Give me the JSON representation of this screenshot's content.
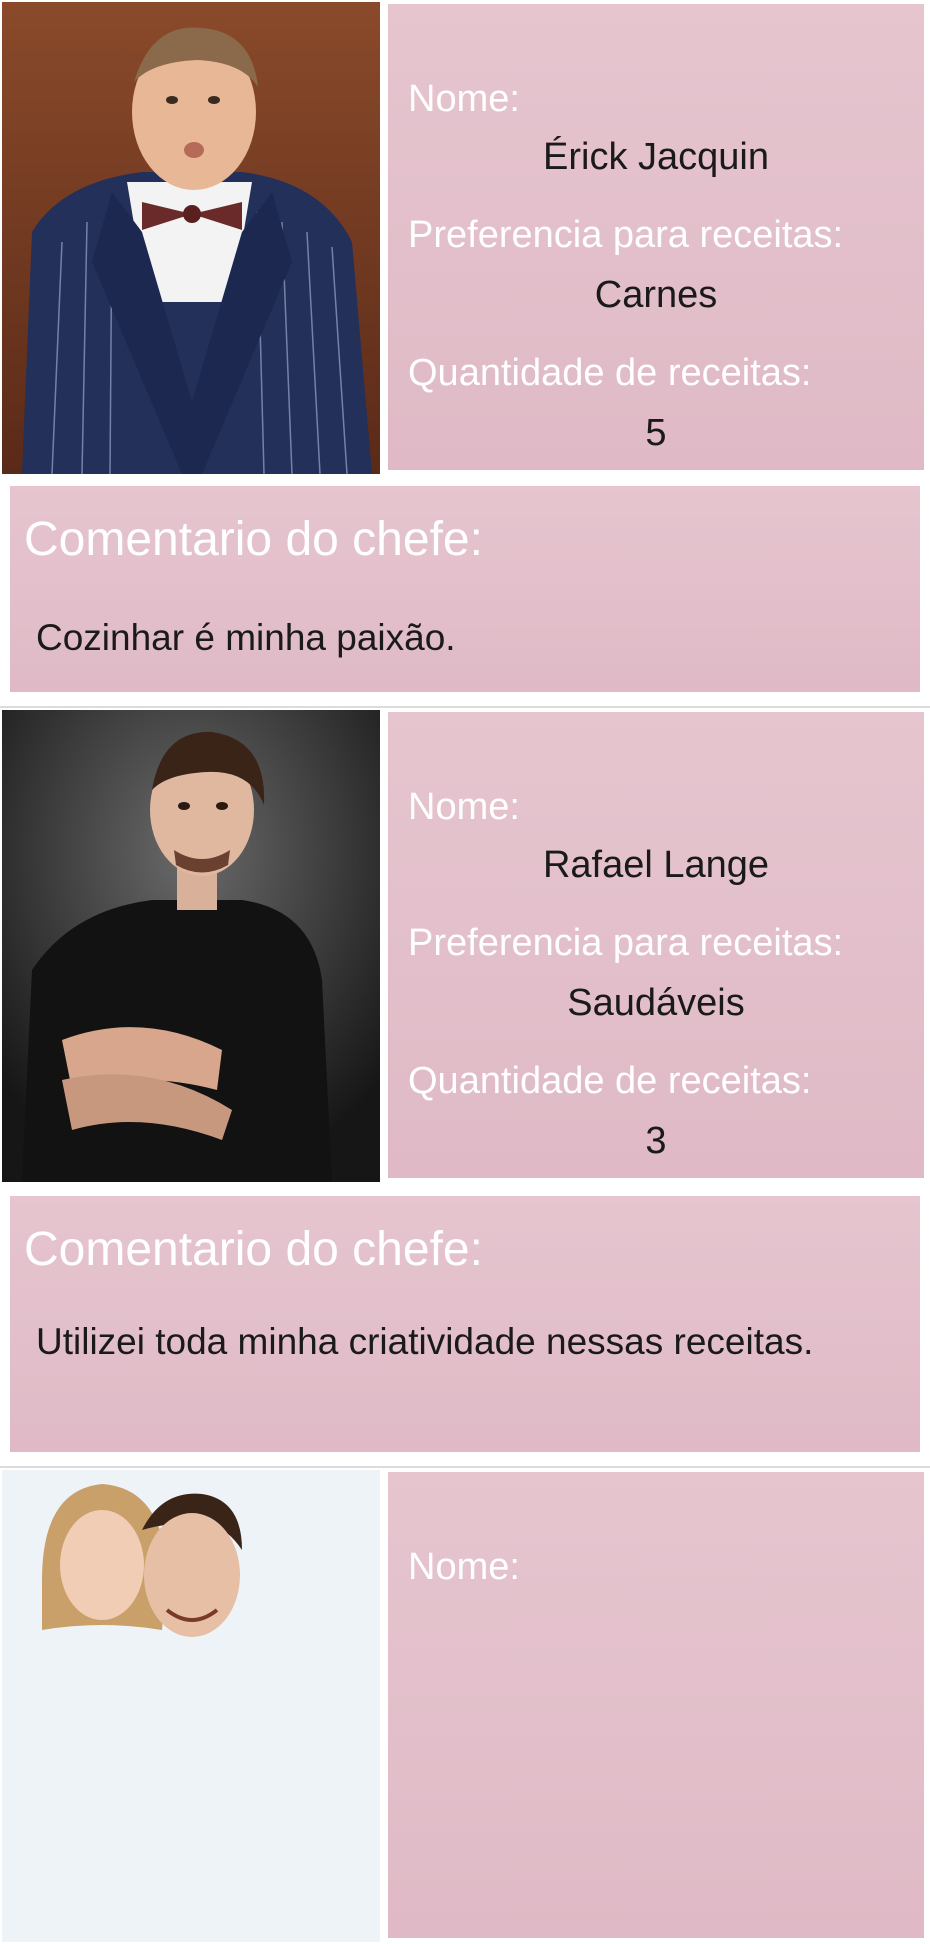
{
  "labels": {
    "name": "Nome:",
    "preference": "Preferencia para receitas:",
    "quantity": "Quantidade de receitas:",
    "comment_title": "Comentario do chefe:"
  },
  "chefs": [
    {
      "name": "Érick Jacquin",
      "preference": "Carnes",
      "quantity": "5",
      "comment": "Cozinhar é minha paixão."
    },
    {
      "name": "Rafael Lange",
      "preference": "Saudáveis",
      "quantity": "3",
      "comment": " Utilizei toda minha criatividade nessas receitas."
    },
    {
      "name": "",
      "preference": "",
      "quantity": "",
      "comment": ""
    }
  ],
  "colors": {
    "card_background": "#e2bfca",
    "label_text": "#ffffff",
    "value_text": "#1a1a1a"
  }
}
